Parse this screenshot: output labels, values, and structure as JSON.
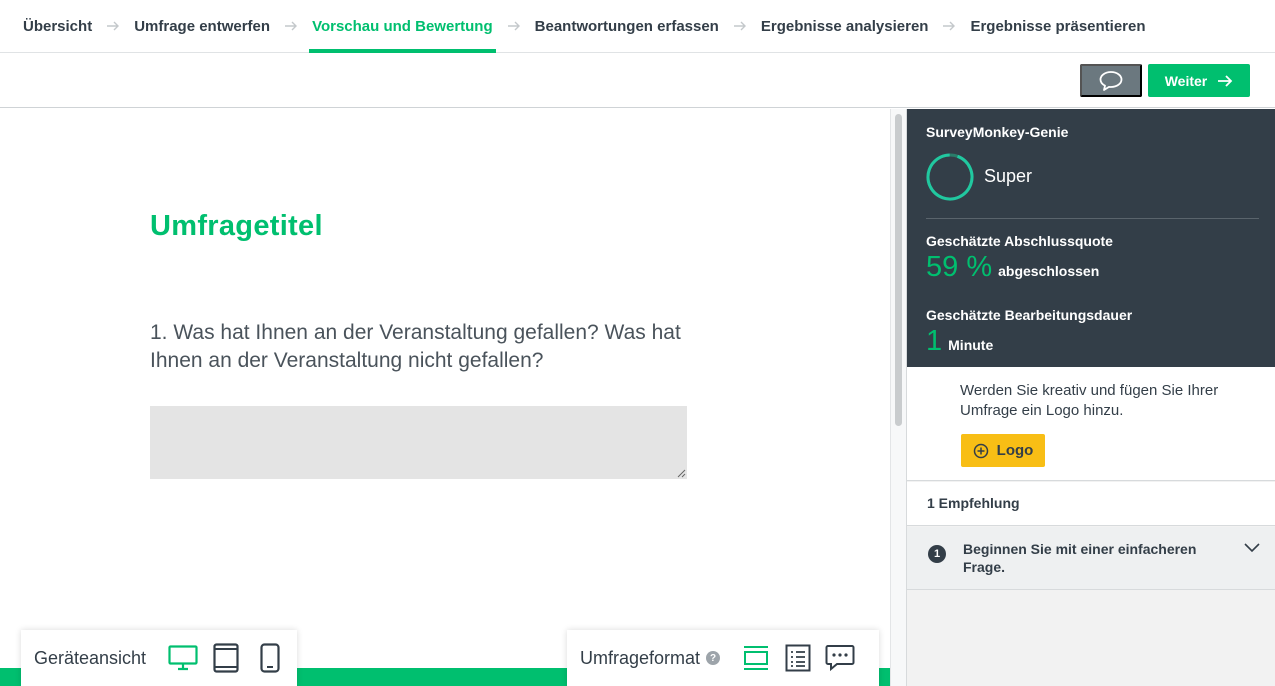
{
  "nav": {
    "steps": [
      {
        "label": "Übersicht"
      },
      {
        "label": "Umfrage entwerfen"
      },
      {
        "label": "Vorschau und Bewertung"
      },
      {
        "label": "Beantwortungen erfassen"
      },
      {
        "label": "Ergebnisse analysieren"
      },
      {
        "label": "Ergebnisse präsentieren"
      }
    ],
    "active_index": 2
  },
  "toolbar": {
    "next_label": "Weiter"
  },
  "survey": {
    "title": "Umfragetitel",
    "question": "1. Was hat Ihnen an der Veranstaltung gefallen? Was hat Ihnen an der Veranstaltung nicht gefallen?"
  },
  "device_bar": {
    "label": "Geräteansicht",
    "devices": [
      "desktop",
      "tablet",
      "mobile"
    ],
    "selected": "desktop"
  },
  "format_bar": {
    "label": "Umfrageformat",
    "help_symbol": "?",
    "formats": [
      "one-question-at-a-time",
      "classic",
      "conversation"
    ],
    "selected": "one-question-at-a-time"
  },
  "genius": {
    "title": "SurveyMonkey-Genie",
    "rating": "Super",
    "completion_label": "Geschätzte Abschlussquote",
    "completion_value": "59 %",
    "completion_unit": "abgeschlossen",
    "duration_label": "Geschätzte Bearbeitungsdauer",
    "duration_value": "1",
    "duration_unit": "Minute"
  },
  "logo_card": {
    "text": "Werden Sie kreativ und fügen Sie Ihrer Umfrage ein Logo hinzu.",
    "button_label": "Logo"
  },
  "recommendations": {
    "header": "1 Empfehlung",
    "items": [
      {
        "number": "1",
        "text": "Beginnen Sie mit einer einfacheren Frage."
      }
    ]
  },
  "colors": {
    "accent": "#00bf6f",
    "dark": "#333e48",
    "logo_button": "#f8be15",
    "comment_button": "#6b787f"
  }
}
